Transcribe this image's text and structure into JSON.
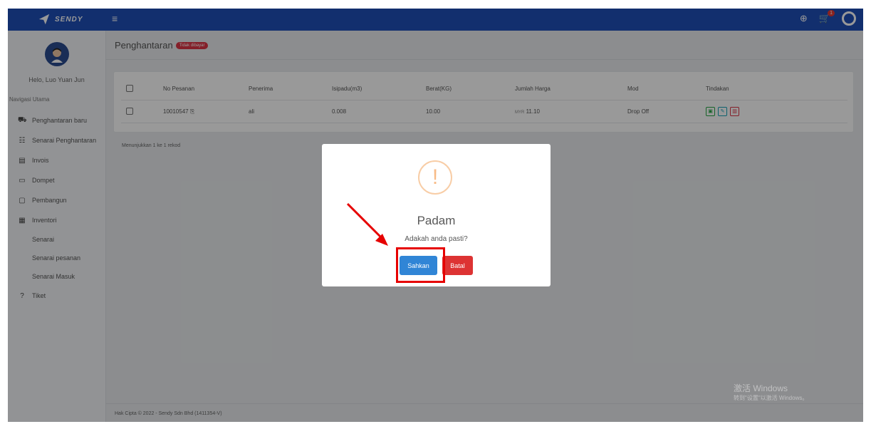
{
  "app": {
    "logo_text": "SENDY",
    "menu_icon": "hamburger-icon",
    "cart_badge": "1"
  },
  "sidebar": {
    "hello": "Helo, Luo Yuan Jun",
    "nav_title": "Navigasi Utama",
    "items": [
      {
        "icon": "truck-icon",
        "label": "Penghantaran baru"
      },
      {
        "icon": "list-icon",
        "label": "Senarai Penghantaran"
      },
      {
        "icon": "invoice-icon",
        "label": "Invois"
      },
      {
        "icon": "wallet-icon",
        "label": "Dompet"
      },
      {
        "icon": "builder-icon",
        "label": "Pembangun"
      },
      {
        "icon": "inventory-icon",
        "label": "Inventori"
      }
    ],
    "sub_items": [
      "Senarai",
      "Senarai pesanan",
      "Senarai Masuk"
    ],
    "ticket": {
      "icon": "help-icon",
      "label": "Tiket"
    }
  },
  "page": {
    "title": "Penghantaran",
    "status_badge": "Tidak dibayar",
    "columns": [
      "No Pesanan",
      "Penerima",
      "Isipadu(m3)",
      "Berat(KG)",
      "Jumlah Harga",
      "Mod",
      "Tindakan"
    ],
    "rows": [
      {
        "order": "10010547",
        "recipient": "ali",
        "volume": "0.008",
        "weight": "10.00",
        "currency": "MYR",
        "price": "11.10",
        "mode": "Drop Off"
      }
    ],
    "records": "Menunjukkan 1 ke 1 rekod",
    "footer": "Hak Cipta © 2022 - Sendy Sdn Bhd (1411354-V)"
  },
  "modal": {
    "icon": "!",
    "title": "Padam",
    "text": "Adakah anda pasti?",
    "confirm": "Sahkan",
    "cancel": "Batal"
  },
  "watermark": {
    "line1": "激活 Windows",
    "line2": "转到\"设置\"以激活 Windows。"
  },
  "colors": {
    "topbar": "#1e4fb8",
    "confirm": "#3085d6",
    "cancel": "#dd3333",
    "highlight": "#e60000"
  }
}
